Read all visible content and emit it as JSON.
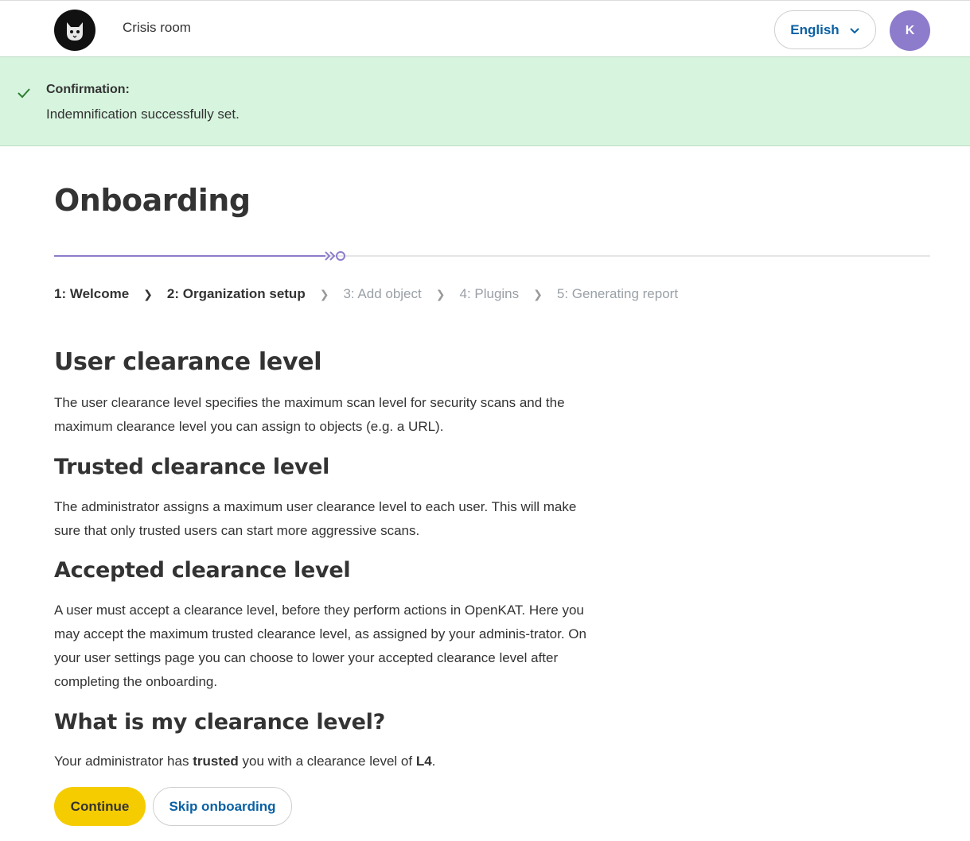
{
  "header": {
    "crisis_room_label": "Crisis room",
    "language_label": "English",
    "avatar_initial": "K"
  },
  "alert": {
    "title": "Confirmation:",
    "message": "Indemnification successfully set."
  },
  "page_title": "Onboarding",
  "progress": {
    "fraction": 0.31
  },
  "steps": [
    {
      "label": "1: Welcome"
    },
    {
      "label": "2: Organization setup"
    },
    {
      "label": "3: Add object"
    },
    {
      "label": "4: Plugins"
    },
    {
      "label": "5: Generating report"
    }
  ],
  "sections": {
    "user": {
      "heading": "User clearance level",
      "text": "The user clearance level specifies the maximum scan level for security scans and the maximum clearance level you can assign to objects (e.g. a URL)."
    },
    "trusted": {
      "heading": "Trusted clearance level",
      "text": "The administrator assigns a maximum user clearance level to each user. This will make sure that only trusted users can start more aggressive scans."
    },
    "accepted": {
      "heading": "Accepted clearance level",
      "text": "A user must accept a clearance level, before they perform actions in OpenKAT. Here you may accept the maximum trusted clearance level, as assigned by your adminis-trator. On your user settings page you can choose to lower your accepted clearance level after completing the onboarding."
    },
    "what": {
      "heading": "What is my clearance level?",
      "text_before": "Your administrator has ",
      "text_bold": "trusted",
      "text_middle": " you with a clearance level of ",
      "level": "L4",
      "text_after": "."
    }
  },
  "buttons": {
    "continue": "Continue",
    "skip": "Skip onboarding"
  },
  "colors": {
    "accent_purple": "#8d7ccc",
    "link_blue": "#0b61a4",
    "primary_yellow": "#f5cc00",
    "alert_green": "#d7f4de"
  },
  "icons": {
    "logo": "cat-logo-icon",
    "language_chevron": "chevron-down-icon",
    "alert_check": "check-icon",
    "step_separator": "chevron-right-icon"
  }
}
